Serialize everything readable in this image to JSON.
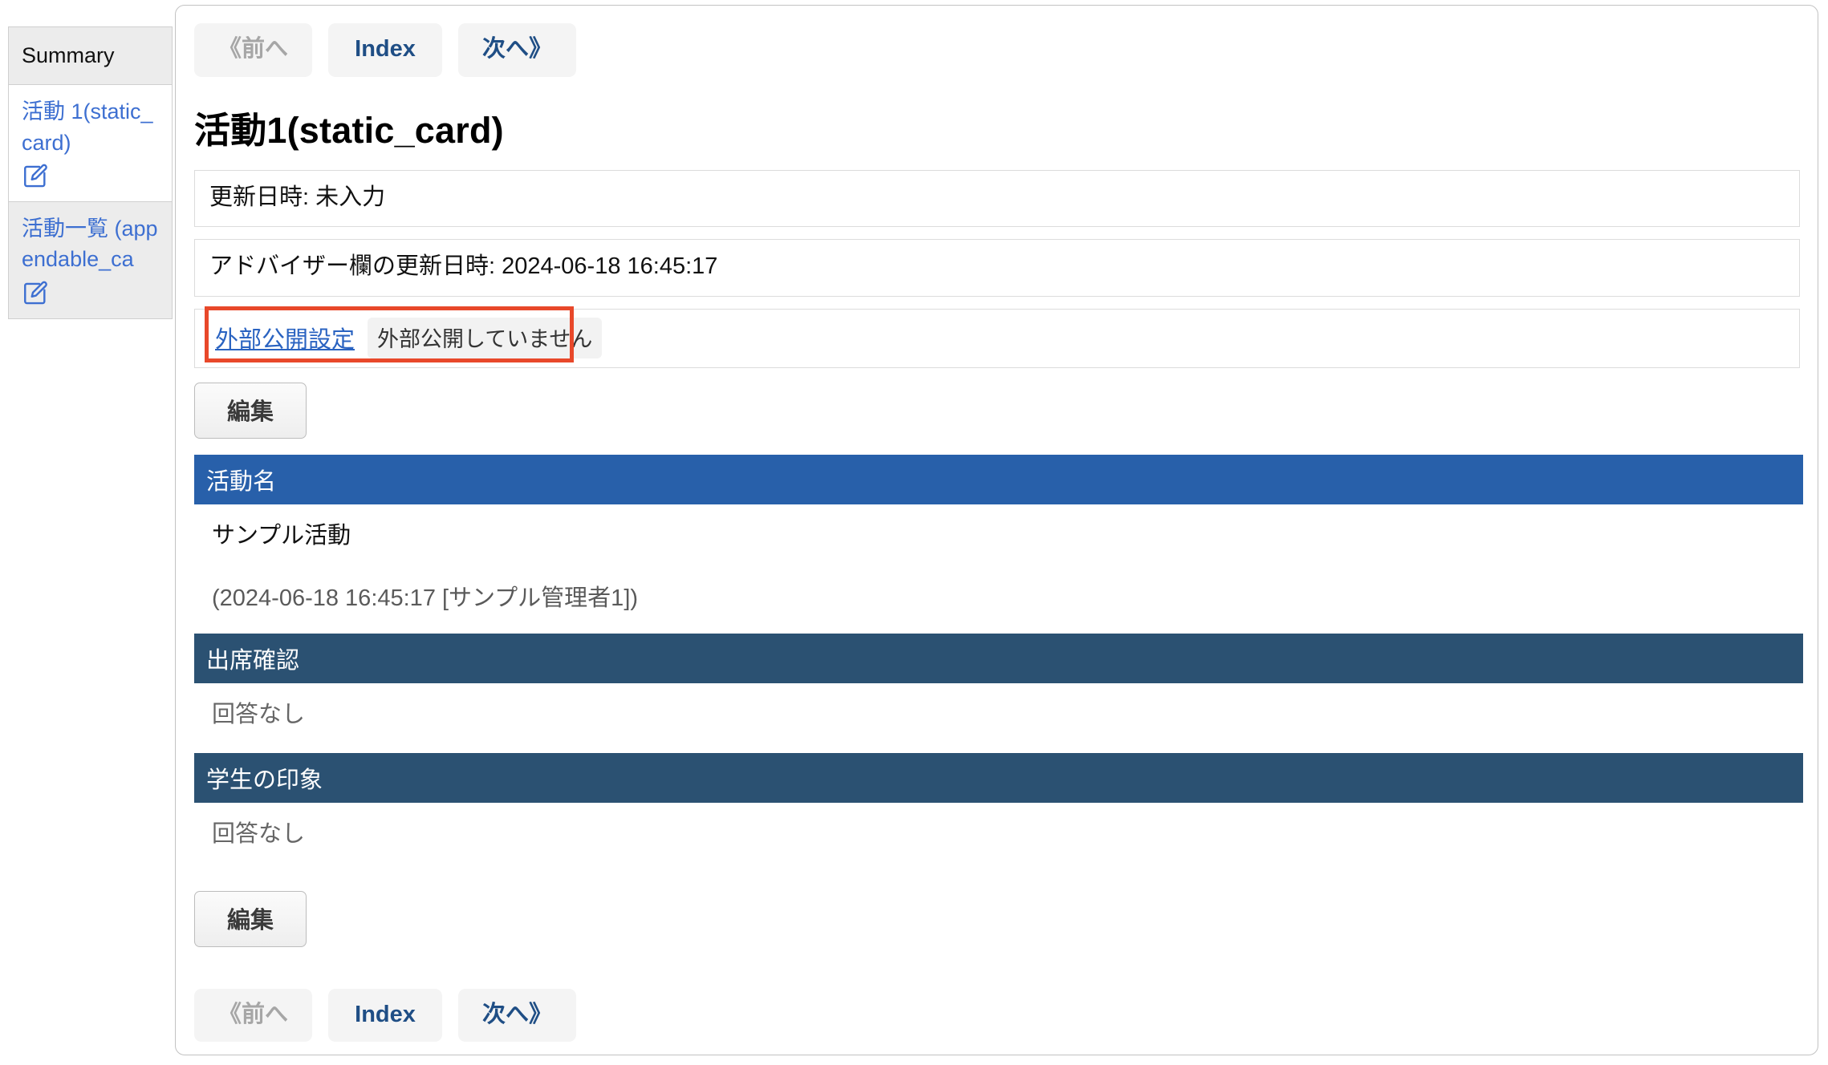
{
  "sidebar": {
    "items": [
      {
        "label": "Summary",
        "type": "plain",
        "active": false,
        "has_edit_icon": false
      },
      {
        "label": "活動 1(static_card)",
        "type": "link",
        "active": true,
        "has_edit_icon": true,
        "edit_icon": "pencil-square-icon"
      },
      {
        "label": "活動一覧 (appendable_ca",
        "type": "link",
        "active": false,
        "has_edit_icon": true,
        "edit_icon": "pencil-square-icon"
      }
    ]
  },
  "nav": {
    "prev_label": "《前へ",
    "index_label": "Index",
    "next_label": "次へ》",
    "prev_disabled": true
  },
  "main": {
    "title": "活動1(static_card)",
    "info_rows": [
      {
        "text": "更新日時: 未入力"
      },
      {
        "text": "アドバイザー欄の更新日時: 2024-06-18 16:45:17"
      }
    ],
    "publication": {
      "link_label": "外部公開設定",
      "status_label": "外部公開していません",
      "highlight_color": "#e8482a"
    },
    "edit_label_top": "編集",
    "edit_label_bottom": "編集",
    "sections": [
      {
        "header": "活動名",
        "header_color": "#2860aa",
        "body": "サンプル活動",
        "body_muted": false,
        "meta": "(2024-06-18 16:45:17 [サンプル管理者1])"
      },
      {
        "header": "出席確認",
        "header_color": "#2b5172",
        "body": "回答なし",
        "body_muted": true,
        "meta": ""
      },
      {
        "header": "学生の印象",
        "header_color": "#2b5172",
        "body": "回答なし",
        "body_muted": true,
        "meta": ""
      }
    ]
  }
}
